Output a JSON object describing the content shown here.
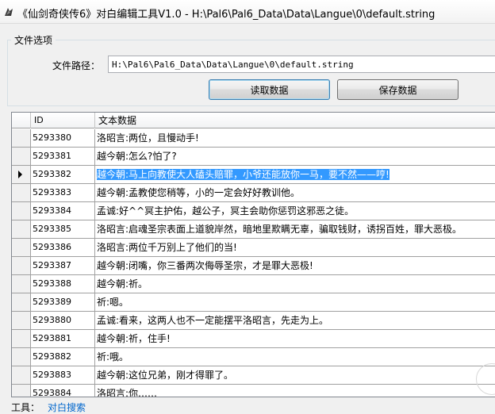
{
  "window": {
    "title": "《仙剑奇侠传6》对白编辑工具V1.0 - H:\\Pal6\\Pal6_Data\\Data\\Langue\\0\\default.string"
  },
  "options": {
    "group_label": "文件选项",
    "path_label": "文件路径：",
    "path_value": "H:\\Pal6\\Pal6_Data\\Data\\Langue\\0\\default.string",
    "read_button": "读取数据",
    "save_button": "保存数据"
  },
  "grid": {
    "columns": [
      "ID",
      "文本数据"
    ],
    "rows": [
      {
        "id": "5293380",
        "text": "洛昭言:两位，且慢动手!"
      },
      {
        "id": "5293381",
        "text": "越今朝:怎么?怕了?"
      },
      {
        "id": "5293382",
        "text": "越今朝:马上向教使大人磕头赔罪，小爷还能放你一马，要不然——哼!"
      },
      {
        "id": "5293383",
        "text": "越今朝:孟教使您稍等，小的一定会好好教训他。"
      },
      {
        "id": "5293384",
        "text": "孟诚:好^^冥主护佑，越公子，冥主会助你惩罚这邪恶之徒。"
      },
      {
        "id": "5293385",
        "text": "洛昭言:启魂圣宗表面上道貌岸然，暗地里欺瞒无辜，骗取钱财，诱拐百姓，罪大恶极。"
      },
      {
        "id": "5293386",
        "text": "洛昭言:两位千万别上了他们的当!"
      },
      {
        "id": "5293387",
        "text": "越今朝:闭嘴，你三番两次侮辱圣宗，才是罪大恶极!"
      },
      {
        "id": "5293388",
        "text": "越今朝:祈。"
      },
      {
        "id": "5293389",
        "text": "祈:嗯。"
      },
      {
        "id": "5293880",
        "text": "孟诚:看来，这两人也不一定能摆平洛昭言，先走为上。"
      },
      {
        "id": "5293881",
        "text": "越今朝:祈，住手!"
      },
      {
        "id": "5293882",
        "text": "祈:哦。"
      },
      {
        "id": "5293883",
        "text": "越今朝:这位兄弟，刚才得罪了。"
      },
      {
        "id": "5293884",
        "text": "洛昭言:你……"
      }
    ],
    "selected_row_index": 2
  },
  "bottom": {
    "label": "工具：",
    "link": "对白搜索"
  },
  "colors": {
    "selection": "#3399ff",
    "link": "#0066cc"
  }
}
